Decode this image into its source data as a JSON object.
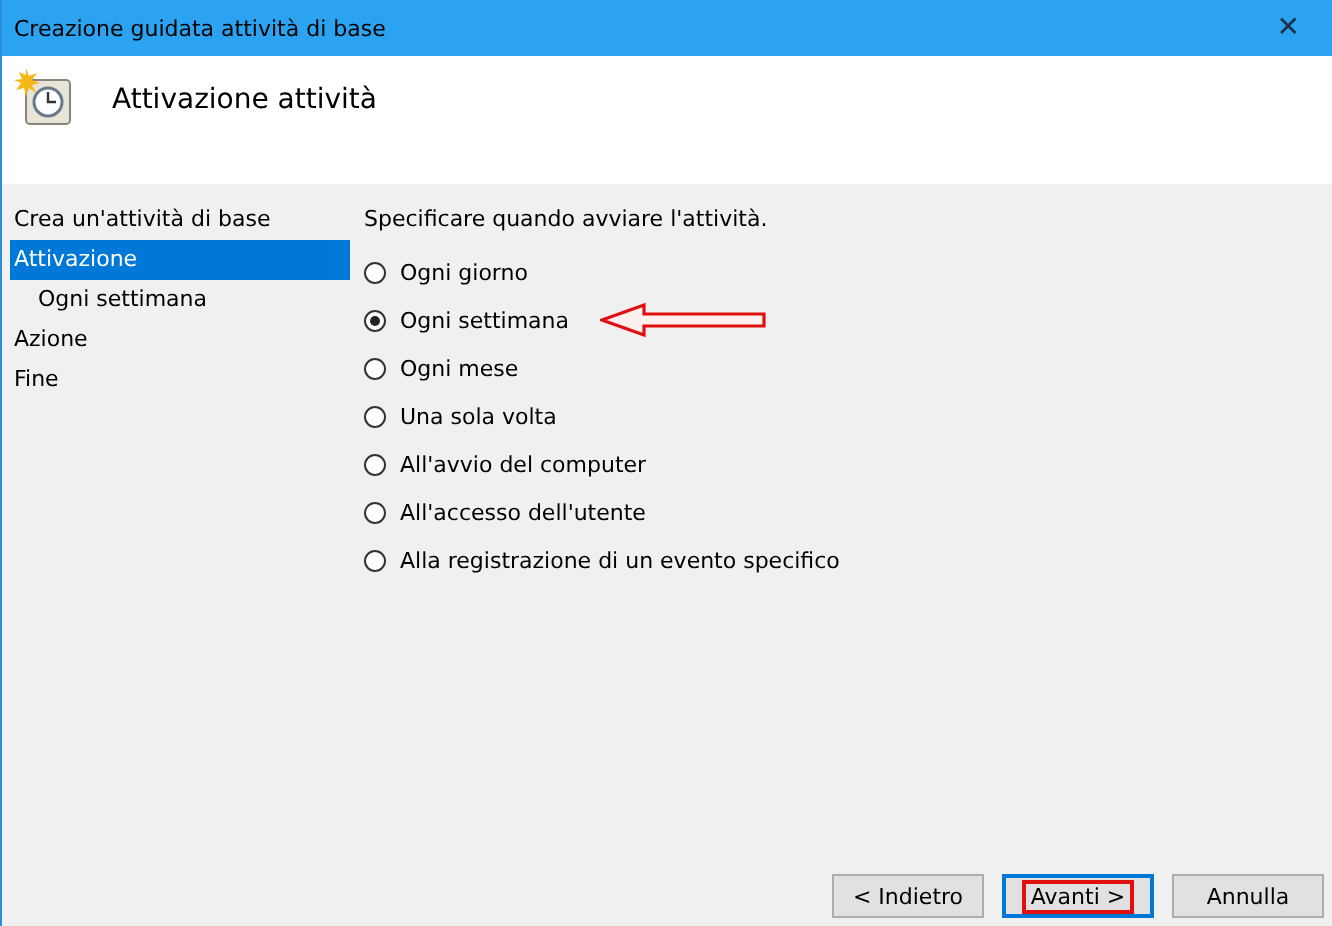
{
  "window": {
    "title": "Creazione guidata attività di base",
    "close": "✕"
  },
  "header": {
    "title": "Attivazione attività"
  },
  "sidebar": {
    "items": [
      {
        "label": "Crea un'attività di base",
        "selected": false
      },
      {
        "label": "Attivazione",
        "selected": true,
        "children": [
          {
            "label": "Ogni settimana",
            "selected": false
          }
        ]
      },
      {
        "label": "Azione",
        "selected": false
      },
      {
        "label": "Fine",
        "selected": false
      }
    ]
  },
  "prompt": "Specificare quando avviare l'attività.",
  "options": [
    {
      "label": "Ogni giorno",
      "selected": false,
      "annotated": false
    },
    {
      "label": "Ogni settimana",
      "selected": true,
      "annotated": true
    },
    {
      "label": "Ogni mese",
      "selected": false,
      "annotated": false
    },
    {
      "label": "Una sola volta",
      "selected": false,
      "annotated": false
    },
    {
      "label": "All'avvio del computer",
      "selected": false,
      "annotated": false
    },
    {
      "label": "All'accesso dell'utente",
      "selected": false,
      "annotated": false
    },
    {
      "label": "Alla registrazione di un evento specifico",
      "selected": false,
      "annotated": false
    }
  ],
  "buttons": [
    {
      "label": "< Indietro",
      "default": false,
      "highlighted": false
    },
    {
      "label": "Avanti >",
      "default": true,
      "highlighted": true
    },
    {
      "label": "Annulla",
      "default": false,
      "highlighted": false
    }
  ]
}
